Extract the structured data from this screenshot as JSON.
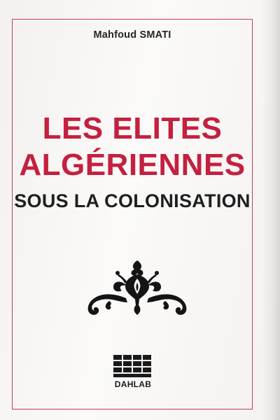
{
  "cover": {
    "author": "Mahfoud SMATI",
    "title_line_1": "LES ELITES",
    "title_line_2": "ALGÉRIENNES",
    "subtitle": "SOUS LA COLONISATION",
    "publisher": "DAHLAB",
    "ornament_icon": "fleur-de-lis-arabesque-icon",
    "publisher_logo_icon": "grid-blocks-logo-icon",
    "colors": {
      "title": "#c4203f",
      "frame": "#c43a54",
      "text": "#1f1f1f",
      "background": "#f7f5f3"
    }
  }
}
